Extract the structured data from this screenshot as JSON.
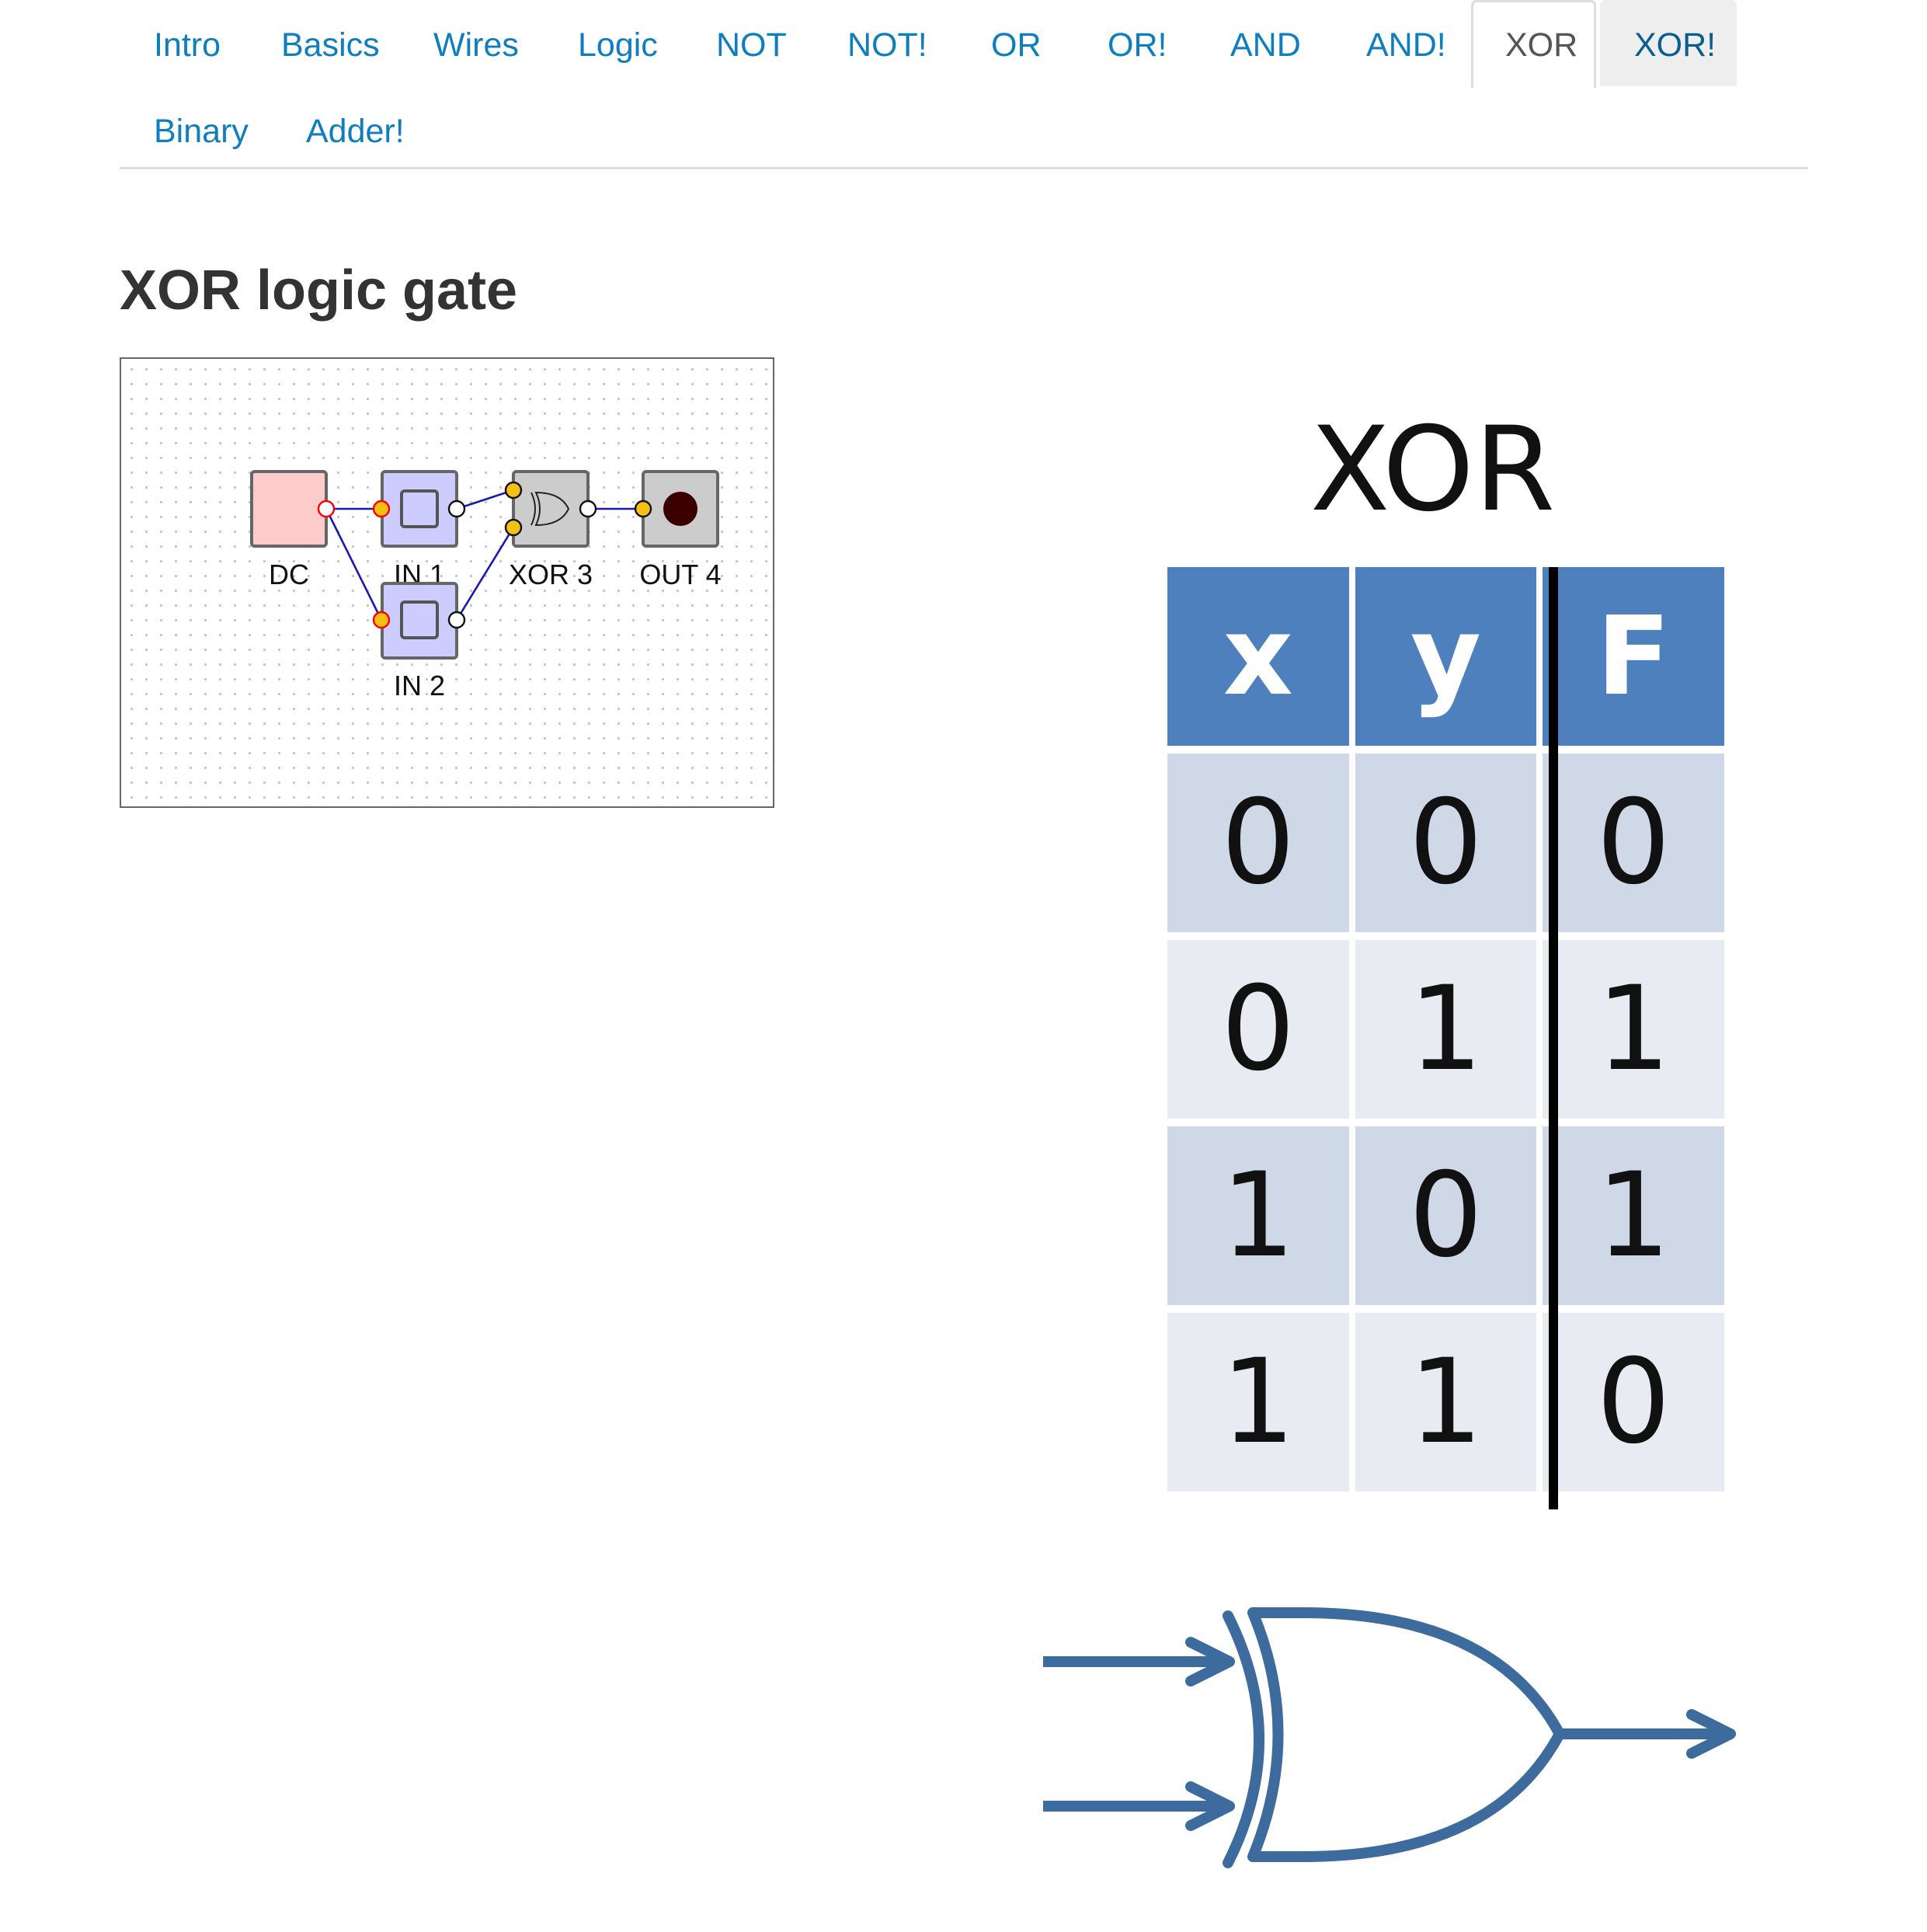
{
  "nav": {
    "tabs": [
      {
        "label": "Intro",
        "state": "normal"
      },
      {
        "label": "Basics",
        "state": "normal"
      },
      {
        "label": "Wires",
        "state": "normal"
      },
      {
        "label": "Logic",
        "state": "normal"
      },
      {
        "label": "NOT",
        "state": "normal"
      },
      {
        "label": "NOT!",
        "state": "normal"
      },
      {
        "label": "OR",
        "state": "normal"
      },
      {
        "label": "OR!",
        "state": "normal"
      },
      {
        "label": "AND",
        "state": "normal"
      },
      {
        "label": "AND!",
        "state": "normal"
      },
      {
        "label": "XOR",
        "state": "active"
      },
      {
        "label": "XOR!",
        "state": "hover"
      },
      {
        "label": "Binary",
        "state": "normal"
      },
      {
        "label": "Adder!",
        "state": "normal"
      }
    ]
  },
  "main": {
    "title": "XOR logic gate"
  },
  "simulator": {
    "nodes": {
      "dc": "DC",
      "in1": "IN 1",
      "in2": "IN 2",
      "xor": "XOR 3",
      "out": "OUT 4"
    },
    "colors": {
      "dc_fill": "#ffcccc",
      "input_fill": "#ccccff",
      "gate_fill": "#cccccc",
      "wire": "#1a1aaa",
      "port_active": "#f5c013",
      "port_powered": "#ff0000",
      "output_led": "#3a0000"
    }
  },
  "truth_table": {
    "title": "XOR",
    "headers": [
      "x",
      "y",
      "F"
    ],
    "rows": [
      [
        "0",
        "0",
        "0"
      ],
      [
        "0",
        "1",
        "1"
      ],
      [
        "1",
        "0",
        "1"
      ],
      [
        "1",
        "1",
        "0"
      ]
    ],
    "colors": {
      "header": "#4e80bd",
      "row_dark": "#cfd8e6",
      "row_light": "#e8ebf2",
      "symbol": "#3d6b9e"
    }
  },
  "colors": {
    "link": "#0f7ebf",
    "text": "#333333"
  }
}
